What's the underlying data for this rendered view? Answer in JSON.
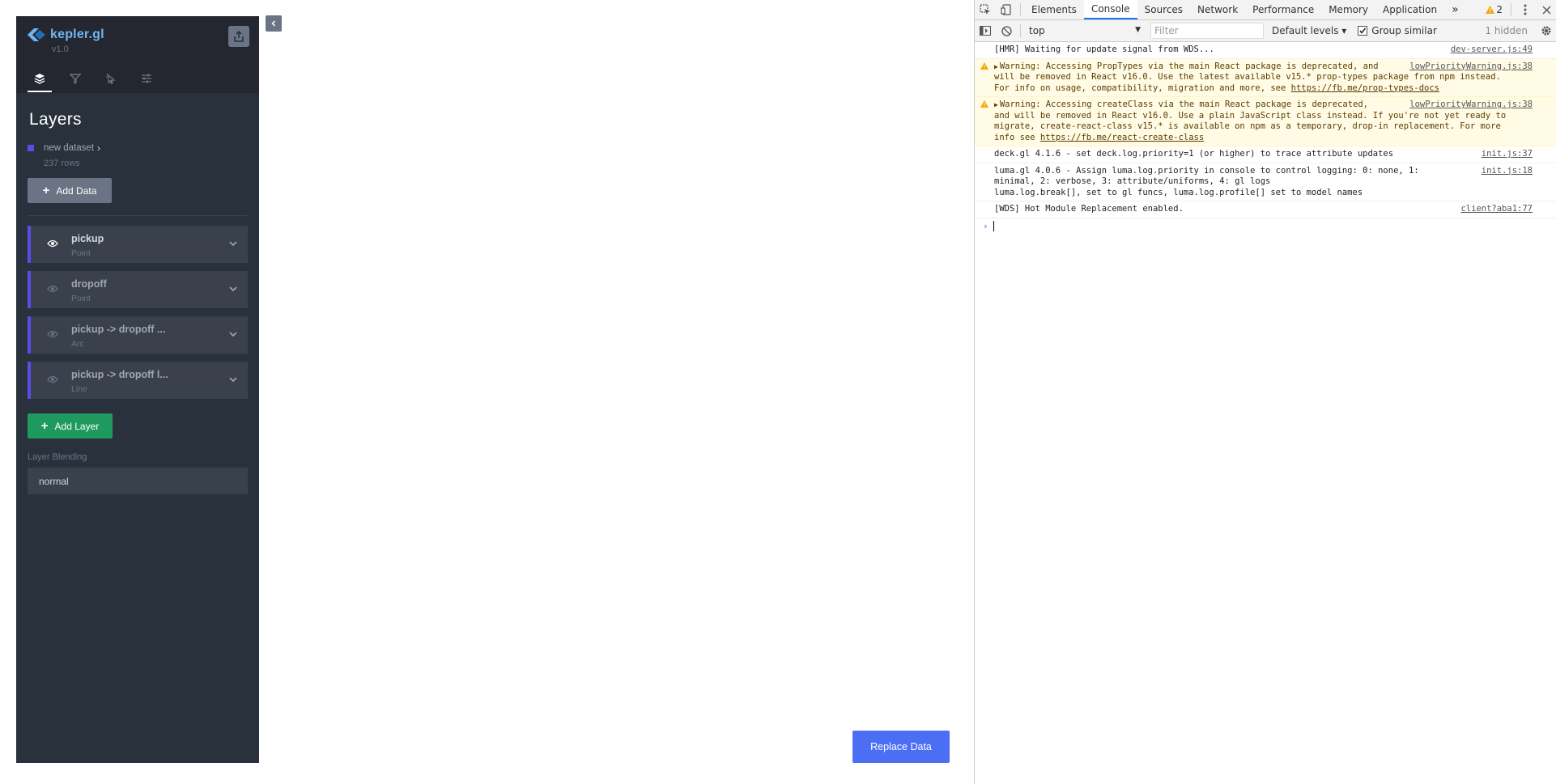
{
  "app": {
    "logo_title": "kepler.gl",
    "version": "v1.0",
    "panel_tabs": [
      "layers-icon",
      "filter-icon",
      "interaction-icon",
      "map-settings-icon"
    ],
    "section_title": "Layers",
    "dataset": {
      "name": "new dataset",
      "rows": "237 rows",
      "color": "#5a4ce6"
    },
    "add_data_label": "Add Data",
    "layers": [
      {
        "name": "pickup",
        "type": "Point",
        "visible": true
      },
      {
        "name": "dropoff",
        "type": "Point",
        "visible": false
      },
      {
        "name": "pickup -> dropoff ...",
        "type": "Arc",
        "visible": false
      },
      {
        "name": "pickup -> dropoff l...",
        "type": "Line",
        "visible": false
      }
    ],
    "add_layer_label": "Add Layer",
    "blending_label": "Layer Blending",
    "blending_value": "normal",
    "replace_data_label": "Replace Data",
    "colors": {
      "panel": "#29323C",
      "header": "#242730",
      "accent": "#5a4ce6",
      "add_layer": "#1f9a5e",
      "replace": "#4b6ef5"
    }
  },
  "devtools": {
    "tabs": [
      "Elements",
      "Console",
      "Sources",
      "Network",
      "Performance",
      "Memory",
      "Application"
    ],
    "active_tab": "Console",
    "more_tabs": "»",
    "warning_count": "2",
    "toolbar": {
      "context": "top",
      "filter_placeholder": "Filter",
      "levels": "Default levels ▾",
      "group_similar": "Group similar",
      "hidden": "1 hidden"
    },
    "messages": [
      {
        "level": "info",
        "text": "[HMR] Waiting for update signal from WDS...",
        "source": "dev-server.js:49"
      },
      {
        "level": "warning",
        "text": "Warning: Accessing PropTypes via the main React package is deprecated, and ",
        "text2": "will be removed in  React v16.0. Use the latest available v15.* prop-types package from npm instead.",
        "text3": "For info on usage, compatibility, migration and more, see ",
        "link": "https://fb.me/prop-types-docs",
        "source": "lowPriorityWarning.js:38"
      },
      {
        "level": "warning",
        "text": "Warning: Accessing createClass via the main React package is deprecated,",
        "text2": "and will be removed in React v16.0. Use a plain JavaScript class instead. If you're not yet ready to",
        "text3": "migrate, create-react-class v15.* is available on npm as a temporary, drop-in replacement. For more",
        "text4": "info see ",
        "link": "https://fb.me/react-create-class",
        "source": "lowPriorityWarning.js:38"
      },
      {
        "level": "info",
        "text": "deck.gl 4.1.6 - set deck.log.priority=1 (or higher) to trace attribute updates",
        "source": "init.js:37"
      },
      {
        "level": "info",
        "text": "luma.gl 4.0.6 - Assign luma.log.priority in console to control logging: 0: none, 1:",
        "text2": "minimal, 2: verbose, 3: attribute/uniforms, 4: gl logs",
        "text3": "luma.log.break[], set to gl funcs, luma.log.profile[] set to model names",
        "source": "init.js:18"
      },
      {
        "level": "info",
        "text": "[WDS] Hot Module Replacement enabled.",
        "source": "client?aba1:77"
      }
    ],
    "prompt_symbol": "›"
  }
}
